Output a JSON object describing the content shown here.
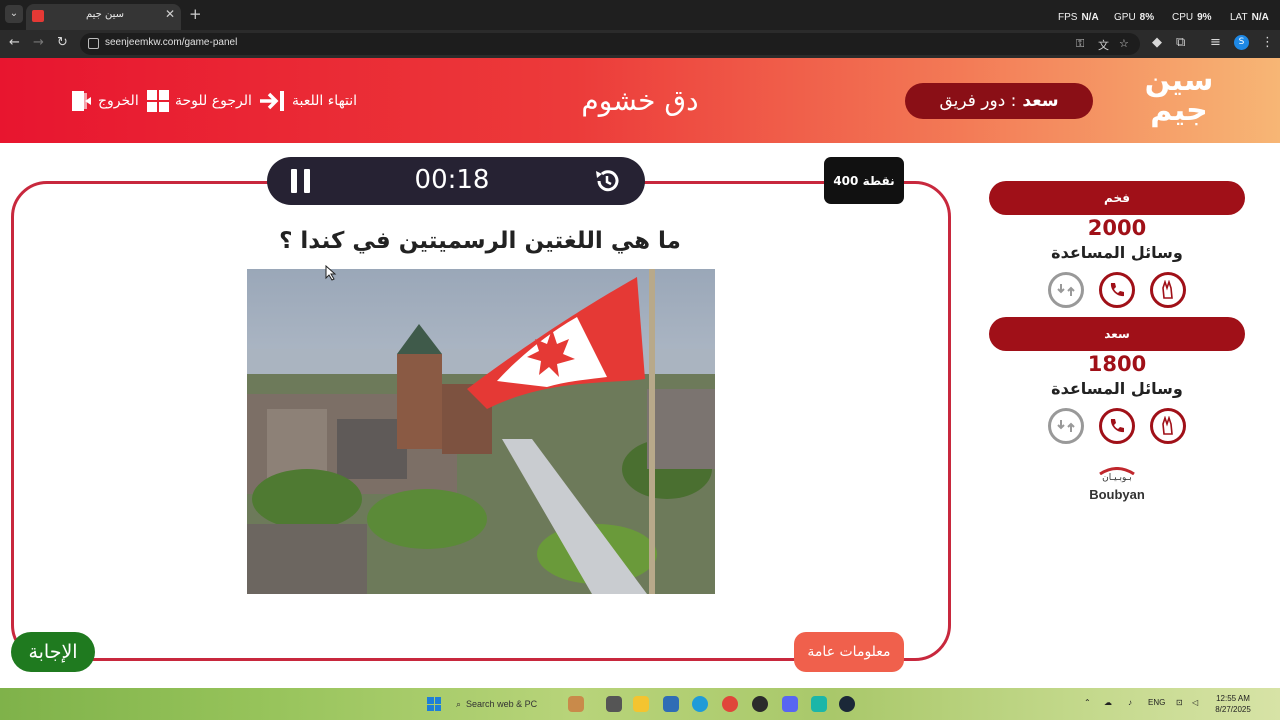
{
  "browser": {
    "tab_title": "سين جيم",
    "new_tab": "+",
    "url": "seenjeemkw.com/game-panel",
    "profile_initial": "S",
    "hud": {
      "fps_label": "FPS",
      "fps_value": "N/A",
      "gpu_label": "GPU",
      "gpu_value": "8%",
      "cpu_label": "CPU",
      "cpu_value": "9%",
      "lat_label": "LAT",
      "lat_value": "N/A"
    }
  },
  "header": {
    "logo_line1": "سين",
    "logo_line2": "جيم",
    "turn_prefix": "دور فريق :",
    "turn_team": "سعد",
    "game_title": "دق خشوم",
    "end_game": "انتهاء اللعبة",
    "back_to_board": "الرجوع للوحة",
    "exit": "الخروج"
  },
  "question": {
    "timer": "00:18",
    "points": "400 نقطة",
    "text": "ما هي اللغتين الرسميتين في كندا ؟",
    "category": "معلومات عامة",
    "answer_button": "الإجابة"
  },
  "teams": [
    {
      "name": "فخم",
      "score": "2000",
      "helps_label": "وسائل المساعدة"
    },
    {
      "name": "سعد",
      "score": "1800",
      "helps_label": "وسائل المساعدة"
    }
  ],
  "sponsor": {
    "arabic": "بـوبـيـان",
    "english": "Boubyan"
  },
  "taskbar": {
    "search_placeholder": "Search web & PC",
    "language": "ENG",
    "time": "12:55 AM",
    "date": "8/27/2025"
  },
  "colors": {
    "header_red": "#e8152f",
    "header_orange": "#f7b675",
    "team_red": "#a01018",
    "frame_red": "#c8283d",
    "timer_dark": "#262233",
    "category_orange": "#f0604c",
    "answer_green": "#1f7a1f"
  }
}
